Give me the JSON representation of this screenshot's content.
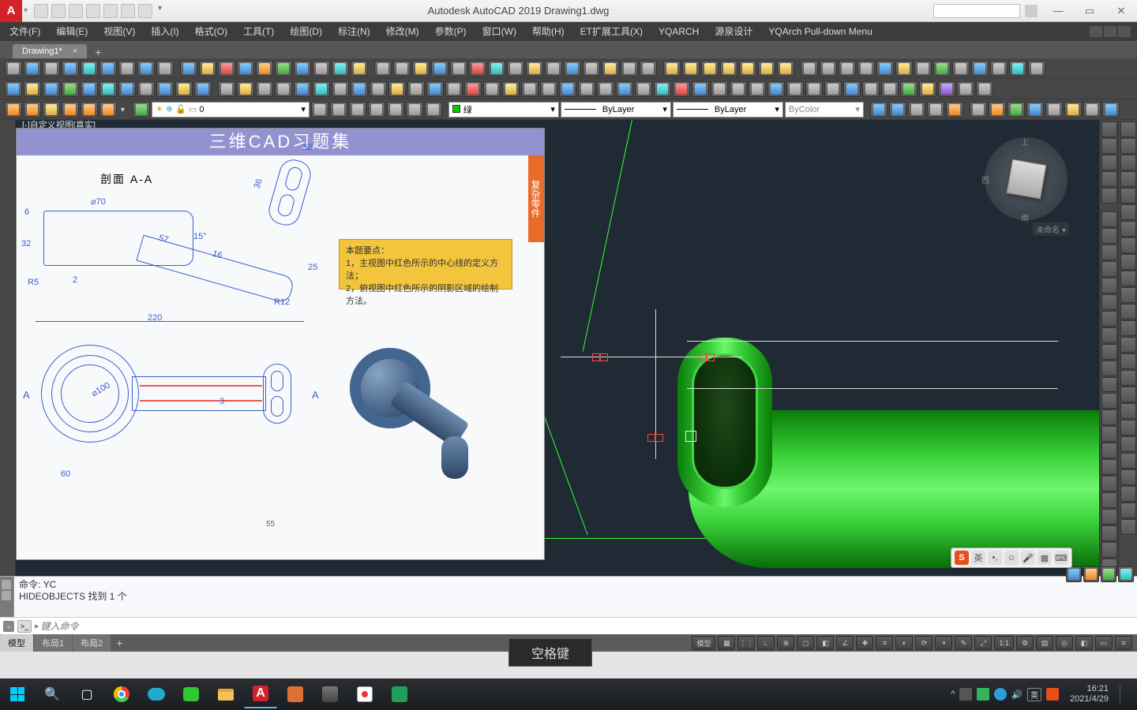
{
  "app": {
    "title": "Autodesk AutoCAD 2019   Drawing1.dwg",
    "logo": "A"
  },
  "winbtns": {
    "min": "—",
    "max": "▭",
    "close": "✕"
  },
  "menu": [
    "文件(F)",
    "编辑(E)",
    "视图(V)",
    "插入(I)",
    "格式(O)",
    "工具(T)",
    "绘图(D)",
    "标注(N)",
    "修改(M)",
    "参数(P)",
    "窗口(W)",
    "帮助(H)",
    "ET扩展工具(X)",
    "YQARCH",
    "源泉设计",
    "YQArch Pull-down Menu"
  ],
  "doctab": {
    "name": "Drawing1*"
  },
  "dropdowns": {
    "layer": "0",
    "color_name": "绿",
    "lineweight": "ByLayer",
    "linetype": "ByLayer",
    "plotstyle": "ByColor"
  },
  "reference": {
    "header": "三维CAD习题集",
    "sidetab": "复杂零件",
    "section": "剖面 A-A",
    "hint_title": "本题要点：",
    "hint_1": "1，主视图中红色所示的中心线的定义方法；",
    "hint_2": "2，俯视图中红色所示的阴影区域的绘制方法。",
    "dims": {
      "d70": "⌀70",
      "d100": "⌀100",
      "l220": "220",
      "l60": "60",
      "a15": "15°",
      "r5": "R5",
      "r12": "R12",
      "w32": "32",
      "h36": "36",
      "h25": "25",
      "t6": "6",
      "t2": "2",
      "t3": "3",
      "h32": "32",
      "h57": "57",
      "h16": "16"
    },
    "arrow_a": "A",
    "page": "55"
  },
  "viewcube": {
    "top": "上",
    "w": "西",
    "s": "南",
    "unnamed": "未命名 ▾"
  },
  "viewport_label": "[-]自定义视图[真实]",
  "cmd": {
    "l1": "命令: YC",
    "l2": "HIDEOBJECTS 找到 1 个",
    "placeholder": "键入命令"
  },
  "tabs": {
    "model": "模型",
    "l1": "布局1",
    "l2": "布局2"
  },
  "status_right": {
    "model": "模型",
    "scale": "1:1"
  },
  "popup": {
    "space": "空格键"
  },
  "ime": {
    "logo": "S",
    "lang": "英"
  },
  "tray": {
    "lang": "英",
    "time": "16:21",
    "date": "2021/4/29"
  }
}
